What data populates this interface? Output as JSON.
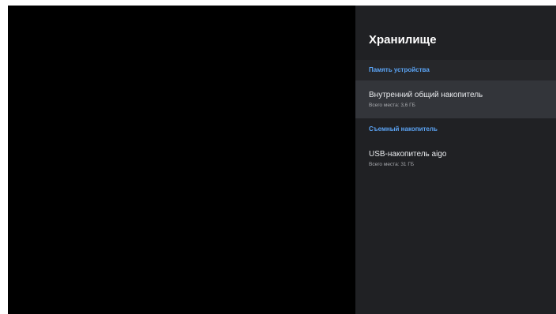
{
  "panel": {
    "title": "Хранилище",
    "sections": [
      {
        "header": "Память устройства",
        "items": [
          {
            "title": "Внутренний общий накопитель",
            "subtitle": "Всего места: 3,6 ГБ"
          }
        ]
      },
      {
        "header": "Съемный накопитель",
        "items": [
          {
            "title": "USB-накопитель aigo",
            "subtitle": "Всего места: 31 ГБ"
          }
        ]
      }
    ]
  },
  "colors": {
    "background": "#000000",
    "panel": "#202124",
    "focused_item": "#33353a",
    "accent": "#5ba4f5",
    "text_primary": "#e8eaed",
    "text_secondary": "#a9abaf"
  }
}
